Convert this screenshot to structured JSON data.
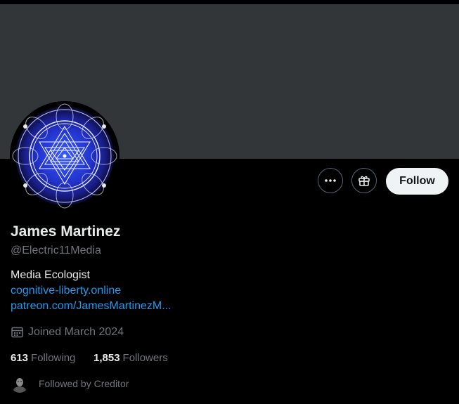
{
  "profile": {
    "name": "James Martinez",
    "handle": "@Electric11Media",
    "bio": "Media Ecologist",
    "links": [
      "cognitive-liberty.online",
      "patreon.com/JamesMartinezM..."
    ],
    "joined": "Joined March 2024",
    "avatar_icon": "sri-yantra-mandala"
  },
  "actions": {
    "more_icon": "more-horizontal-icon",
    "subscribe_icon": "gift-icon",
    "follow_label": "Follow"
  },
  "stats": {
    "following_count": "613",
    "following_label": "Following",
    "followers_count": "1,853",
    "followers_label": "Followers"
  },
  "followed_by": {
    "text": "Followed by Creditor"
  },
  "colors": {
    "background": "#000000",
    "banner": "#333639",
    "link": "#1d9bf0",
    "muted": "#71767b",
    "text": "#e7e9ea",
    "follow_button_bg": "#eff3f4"
  }
}
